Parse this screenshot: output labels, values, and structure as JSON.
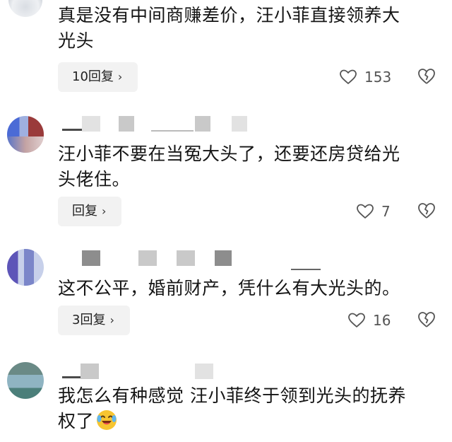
{
  "comments": [
    {
      "text_line1": "真是没有中间商赚差价，汪小菲直接领养大",
      "text_line2": "光头",
      "reply_label": "10回复",
      "likes": "153",
      "icons": {
        "like": "heart-outline-icon",
        "dislike": "broken-heart-icon",
        "chevron": "chevron-right-icon"
      }
    },
    {
      "text_line1": "汪小菲不要在当冤大头了，还要还房贷给光",
      "text_line2": "头佬住。",
      "reply_label": "回复",
      "likes": "7"
    },
    {
      "text_line1": "这不公平，婚前财产，凭什么有大光头的。",
      "reply_label": "3回复",
      "likes": "16"
    },
    {
      "text_line1": "我怎么有种感觉 汪小菲终于领到光头的抚养",
      "text_line2": "权了",
      "emoji": "laughing-crying-emoji"
    }
  ],
  "chevron_glyph": "›",
  "colors": {
    "reply_bg": "#f2f2f2",
    "text": "#151515",
    "meta": "#555555"
  }
}
